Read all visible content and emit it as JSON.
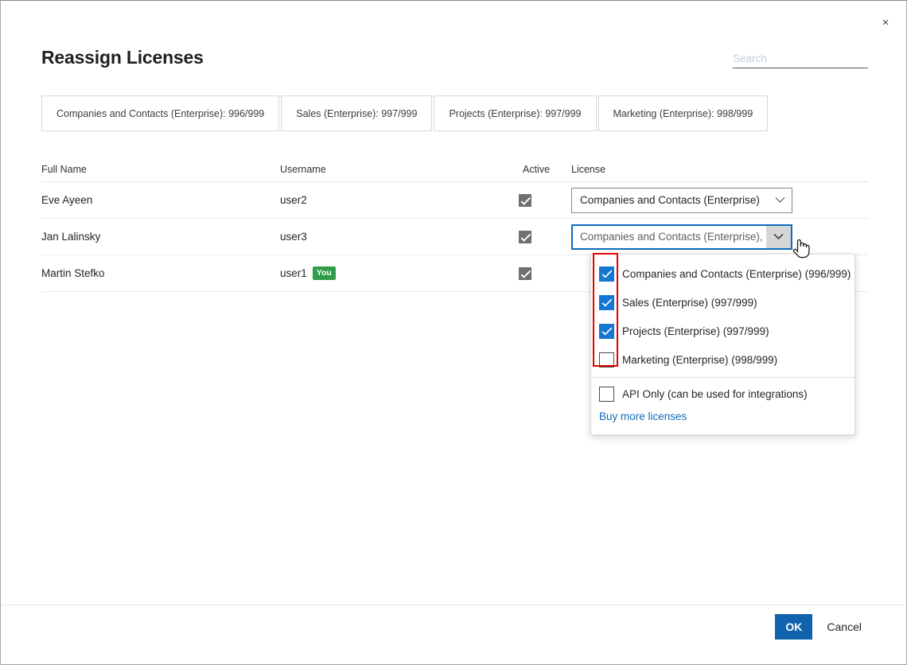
{
  "dialog": {
    "title": "Reassign Licenses",
    "close_icon": "close-icon",
    "close_glyph": "×"
  },
  "search": {
    "placeholder": "Search",
    "value": ""
  },
  "tabs": [
    {
      "label": "Companies and Contacts (Enterprise): 996/999"
    },
    {
      "label": "Sales (Enterprise): 997/999"
    },
    {
      "label": "Projects (Enterprise): 997/999"
    },
    {
      "label": "Marketing (Enterprise): 998/999"
    }
  ],
  "table": {
    "columns": [
      "Full Name",
      "Username",
      "Active",
      "License"
    ],
    "rows": [
      {
        "full_name": "Eve Ayeen",
        "username": "user2",
        "badge": "",
        "active": true,
        "license_value": "Companies and Contacts (Enterprise)",
        "license_open": false
      },
      {
        "full_name": "Jan Lalinsky",
        "username": "user3",
        "badge": "",
        "active": true,
        "license_value": "Companies and Contacts (Enterprise), ",
        "license_open": true
      },
      {
        "full_name": "Martin Stefko",
        "username": "user1",
        "badge": "You",
        "active": true,
        "license_value": "",
        "license_open": false
      }
    ]
  },
  "license_dropdown": {
    "options": [
      {
        "label": "Companies and Contacts (Enterprise) (996/999)",
        "checked": true
      },
      {
        "label": "Sales (Enterprise) (997/999)",
        "checked": true
      },
      {
        "label": "Projects (Enterprise) (997/999)",
        "checked": true
      },
      {
        "label": "Marketing (Enterprise) (998/999)",
        "checked": false
      }
    ],
    "api_only": {
      "label": "API Only (can be used for integrations)",
      "checked": false
    },
    "buy_link": "Buy more licenses"
  },
  "footer": {
    "ok_label": "OK",
    "cancel_label": "Cancel"
  },
  "colors": {
    "accent_blue": "#0f62ab",
    "checkbox_blue": "#1477d4",
    "focus_blue": "#0f6cbd",
    "link_blue": "#0f6cbd",
    "badge_green": "#2e9c49",
    "annotation_red": "#e60000",
    "readonly_gray": "#707070"
  }
}
